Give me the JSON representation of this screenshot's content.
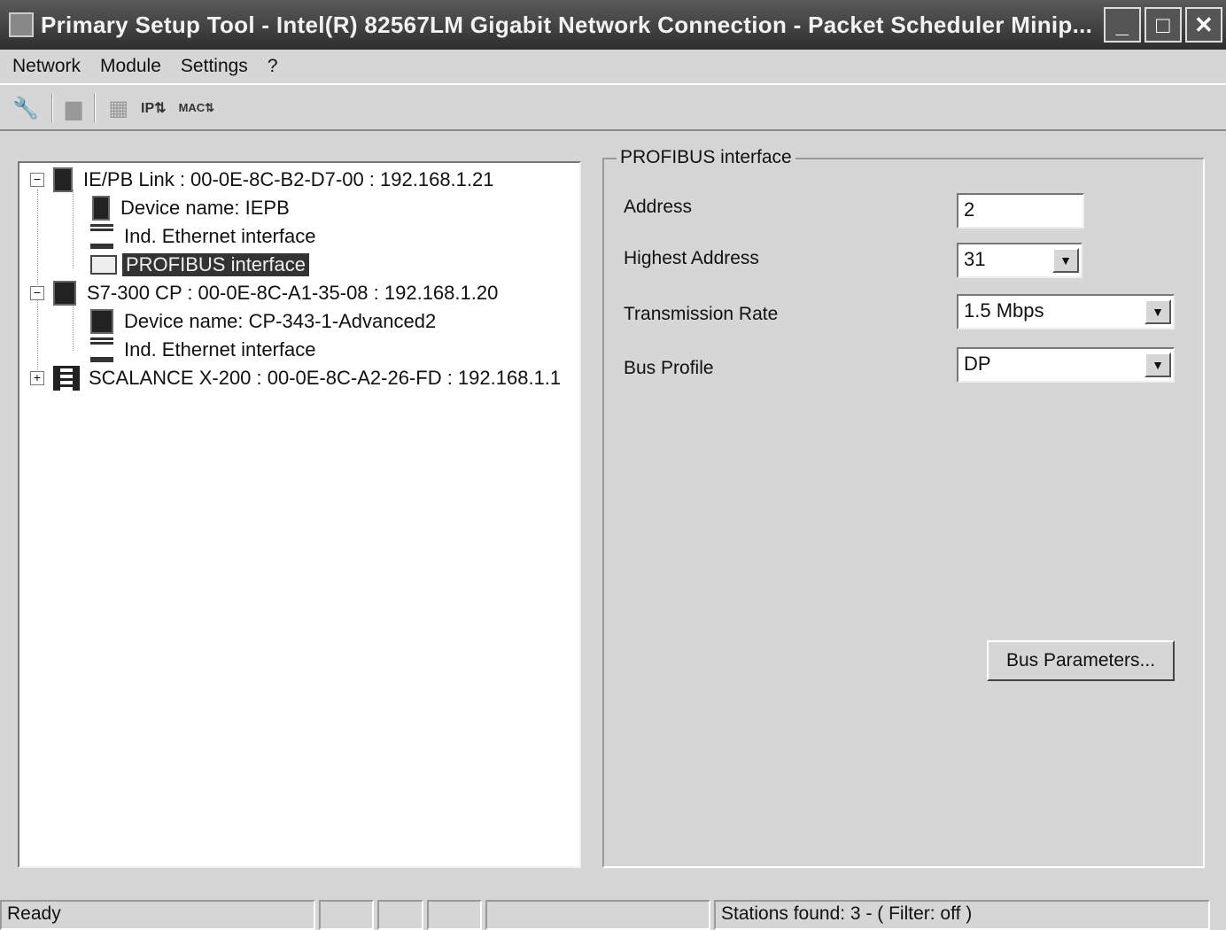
{
  "window": {
    "title": "Primary Setup Tool - Intel(R) 82567LM Gigabit Network Connection - Packet Scheduler Minip...",
    "min": "_",
    "max": "□",
    "close": "✕"
  },
  "menu": [
    "Network",
    "Module",
    "Settings",
    "?"
  ],
  "toolbar": {
    "properties": "🔧",
    "download": "▆",
    "module": "▦",
    "ip": "IP⇅",
    "mac": "MAC⇅"
  },
  "tree": [
    {
      "label": "IE/PB Link : 00-0E-8C-B2-D7-00 : 192.168.1.21",
      "expander": "−"
    },
    {
      "label": "Device name: IEPB"
    },
    {
      "label": "Ind. Ethernet interface"
    },
    {
      "label": "PROFIBUS interface",
      "selected": true
    },
    {
      "label": "S7-300 CP : 00-0E-8C-A1-35-08 : 192.168.1.20",
      "expander": "−"
    },
    {
      "label": "Device name: CP-343-1-Advanced2"
    },
    {
      "label": "Ind. Ethernet interface"
    },
    {
      "label": "SCALANCE X-200 : 00-0E-8C-A2-26-FD : 192.168.1.1",
      "expander": "+"
    }
  ],
  "panel": {
    "title": "PROFIBUS interface",
    "address": {
      "label": "Address",
      "value": "2"
    },
    "highest": {
      "label": "Highest Address",
      "value": "31"
    },
    "rate": {
      "label": "Transmission Rate",
      "value": "1.5 Mbps"
    },
    "profile": {
      "label": "Bus Profile",
      "value": "DP"
    },
    "bus_params": "Bus Parameters...",
    "arrow": "▼"
  },
  "status": {
    "ready": "Ready",
    "stations": "Stations found: 3 - ( Filter: off )"
  }
}
